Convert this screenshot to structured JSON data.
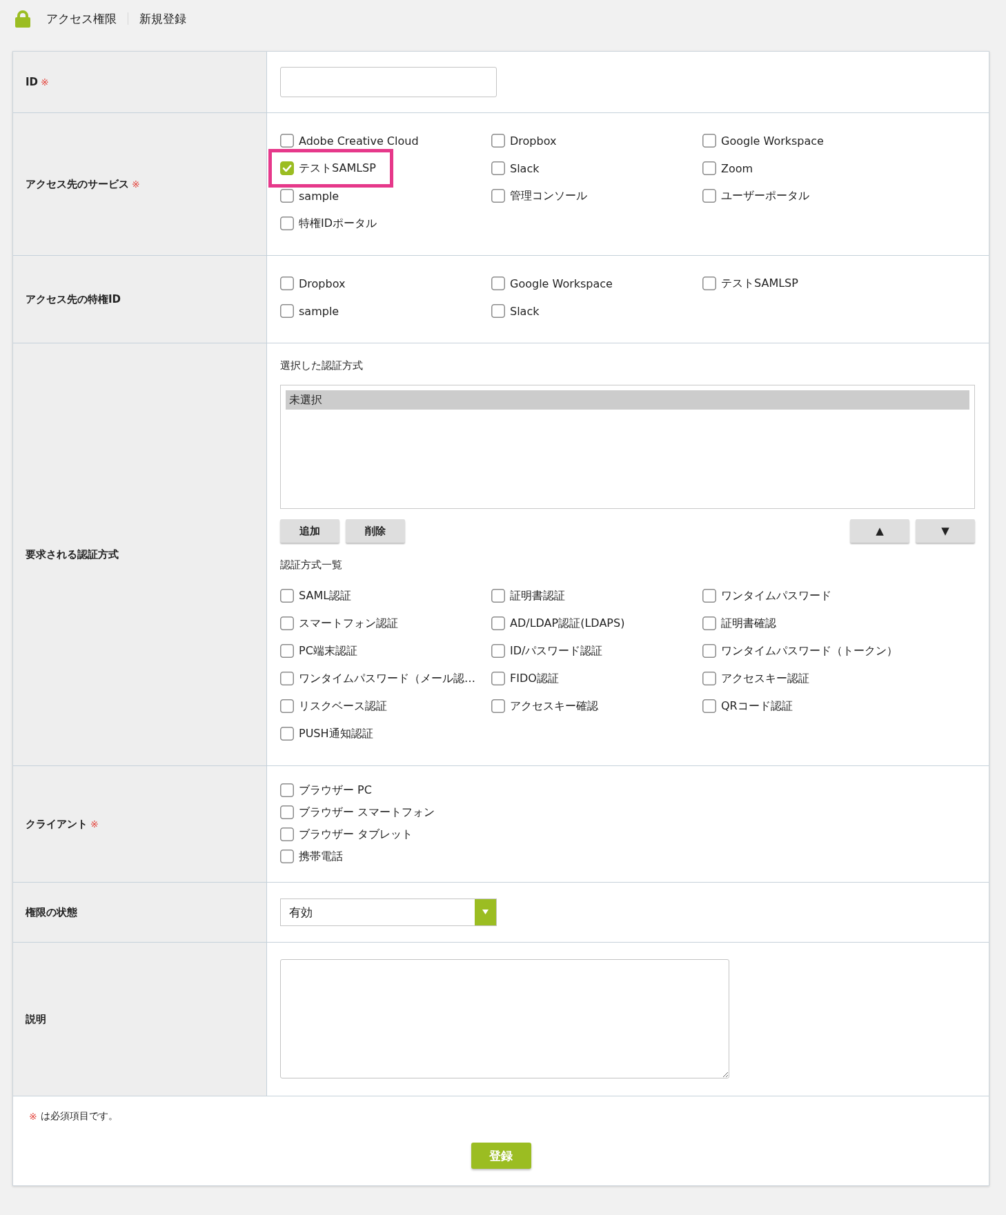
{
  "header": {
    "title": "アクセス権限",
    "subtitle": "新規登録"
  },
  "form": {
    "rows": [
      {
        "kind": "text",
        "label": "ID",
        "required_mark": "※"
      },
      {
        "kind": "checkboxes",
        "label": "アクセス先のサービス",
        "required_mark": "※",
        "options": [
          {
            "label": "Adobe Creative Cloud",
            "checked": false,
            "highlighted": false
          },
          {
            "label": "Dropbox",
            "checked": false,
            "highlighted": false
          },
          {
            "label": "Google Workspace",
            "checked": false,
            "highlighted": false
          },
          {
            "label": "テストSAMLSP",
            "checked": true,
            "highlighted": true
          },
          {
            "label": "Slack",
            "checked": false,
            "highlighted": false
          },
          {
            "label": "Zoom",
            "checked": false,
            "highlighted": false
          },
          {
            "label": "sample",
            "checked": false,
            "highlighted": false
          },
          {
            "label": "管理コンソール",
            "checked": false,
            "highlighted": false
          },
          {
            "label": "ユーザーポータル",
            "checked": false,
            "highlighted": false
          },
          {
            "label": "特権IDポータル",
            "checked": false,
            "highlighted": false
          }
        ]
      },
      {
        "kind": "checkboxes",
        "label": "アクセス先の特権ID",
        "options": [
          {
            "label": "Dropbox",
            "checked": false
          },
          {
            "label": "Google Workspace",
            "checked": false
          },
          {
            "label": "テストSAMLSP",
            "checked": false
          },
          {
            "label": "sample",
            "checked": false
          },
          {
            "label": "Slack",
            "checked": false
          }
        ]
      },
      {
        "kind": "auth_methods",
        "label": "要求される認証方式",
        "selected_heading": "選択した認証方式",
        "selected_methods": [
          {
            "label": "未選択",
            "selected": true
          }
        ],
        "actions": [
          "追加",
          "削除"
        ],
        "order_actions": [
          "▲",
          "▼"
        ],
        "list_heading": "認証方式一覧",
        "options": [
          {
            "label": "SAML認証",
            "checked": false
          },
          {
            "label": "証明書認証",
            "checked": false
          },
          {
            "label": "ワンタイムパスワード",
            "checked": false
          },
          {
            "label": "スマートフォン認証",
            "checked": false
          },
          {
            "label": "AD/LDAP認証(LDAPS)",
            "checked": false
          },
          {
            "label": "証明書確認",
            "checked": false
          },
          {
            "label": "PC端末認証",
            "checked": false
          },
          {
            "label": "ID/パスワード認証",
            "checked": false
          },
          {
            "label": "ワンタイムパスワード（トークン）",
            "checked": false
          },
          {
            "label": "ワンタイムパスワード（メール認…",
            "checked": false
          },
          {
            "label": "FIDO認証",
            "checked": false
          },
          {
            "label": "アクセスキー認証",
            "checked": false
          },
          {
            "label": "リスクベース認証",
            "checked": false
          },
          {
            "label": "アクセスキー確認",
            "checked": false
          },
          {
            "label": "QRコード認証",
            "checked": false
          },
          {
            "label": "PUSH通知認証",
            "checked": false
          }
        ]
      },
      {
        "kind": "checklist",
        "label": "クライアント",
        "required_mark": "※",
        "options": [
          {
            "label": "ブラウザー PC",
            "checked": false
          },
          {
            "label": "ブラウザー スマートフォン",
            "checked": false
          },
          {
            "label": "ブラウザー タブレット",
            "checked": false
          },
          {
            "label": "携帯電話",
            "checked": false
          }
        ]
      },
      {
        "kind": "select",
        "label": "権限の状態",
        "value": "有効"
      },
      {
        "kind": "textarea",
        "label": "説明"
      }
    ]
  },
  "footer": {
    "note_mark": "※",
    "note": "は必須項目です。",
    "submit": "登録"
  }
}
